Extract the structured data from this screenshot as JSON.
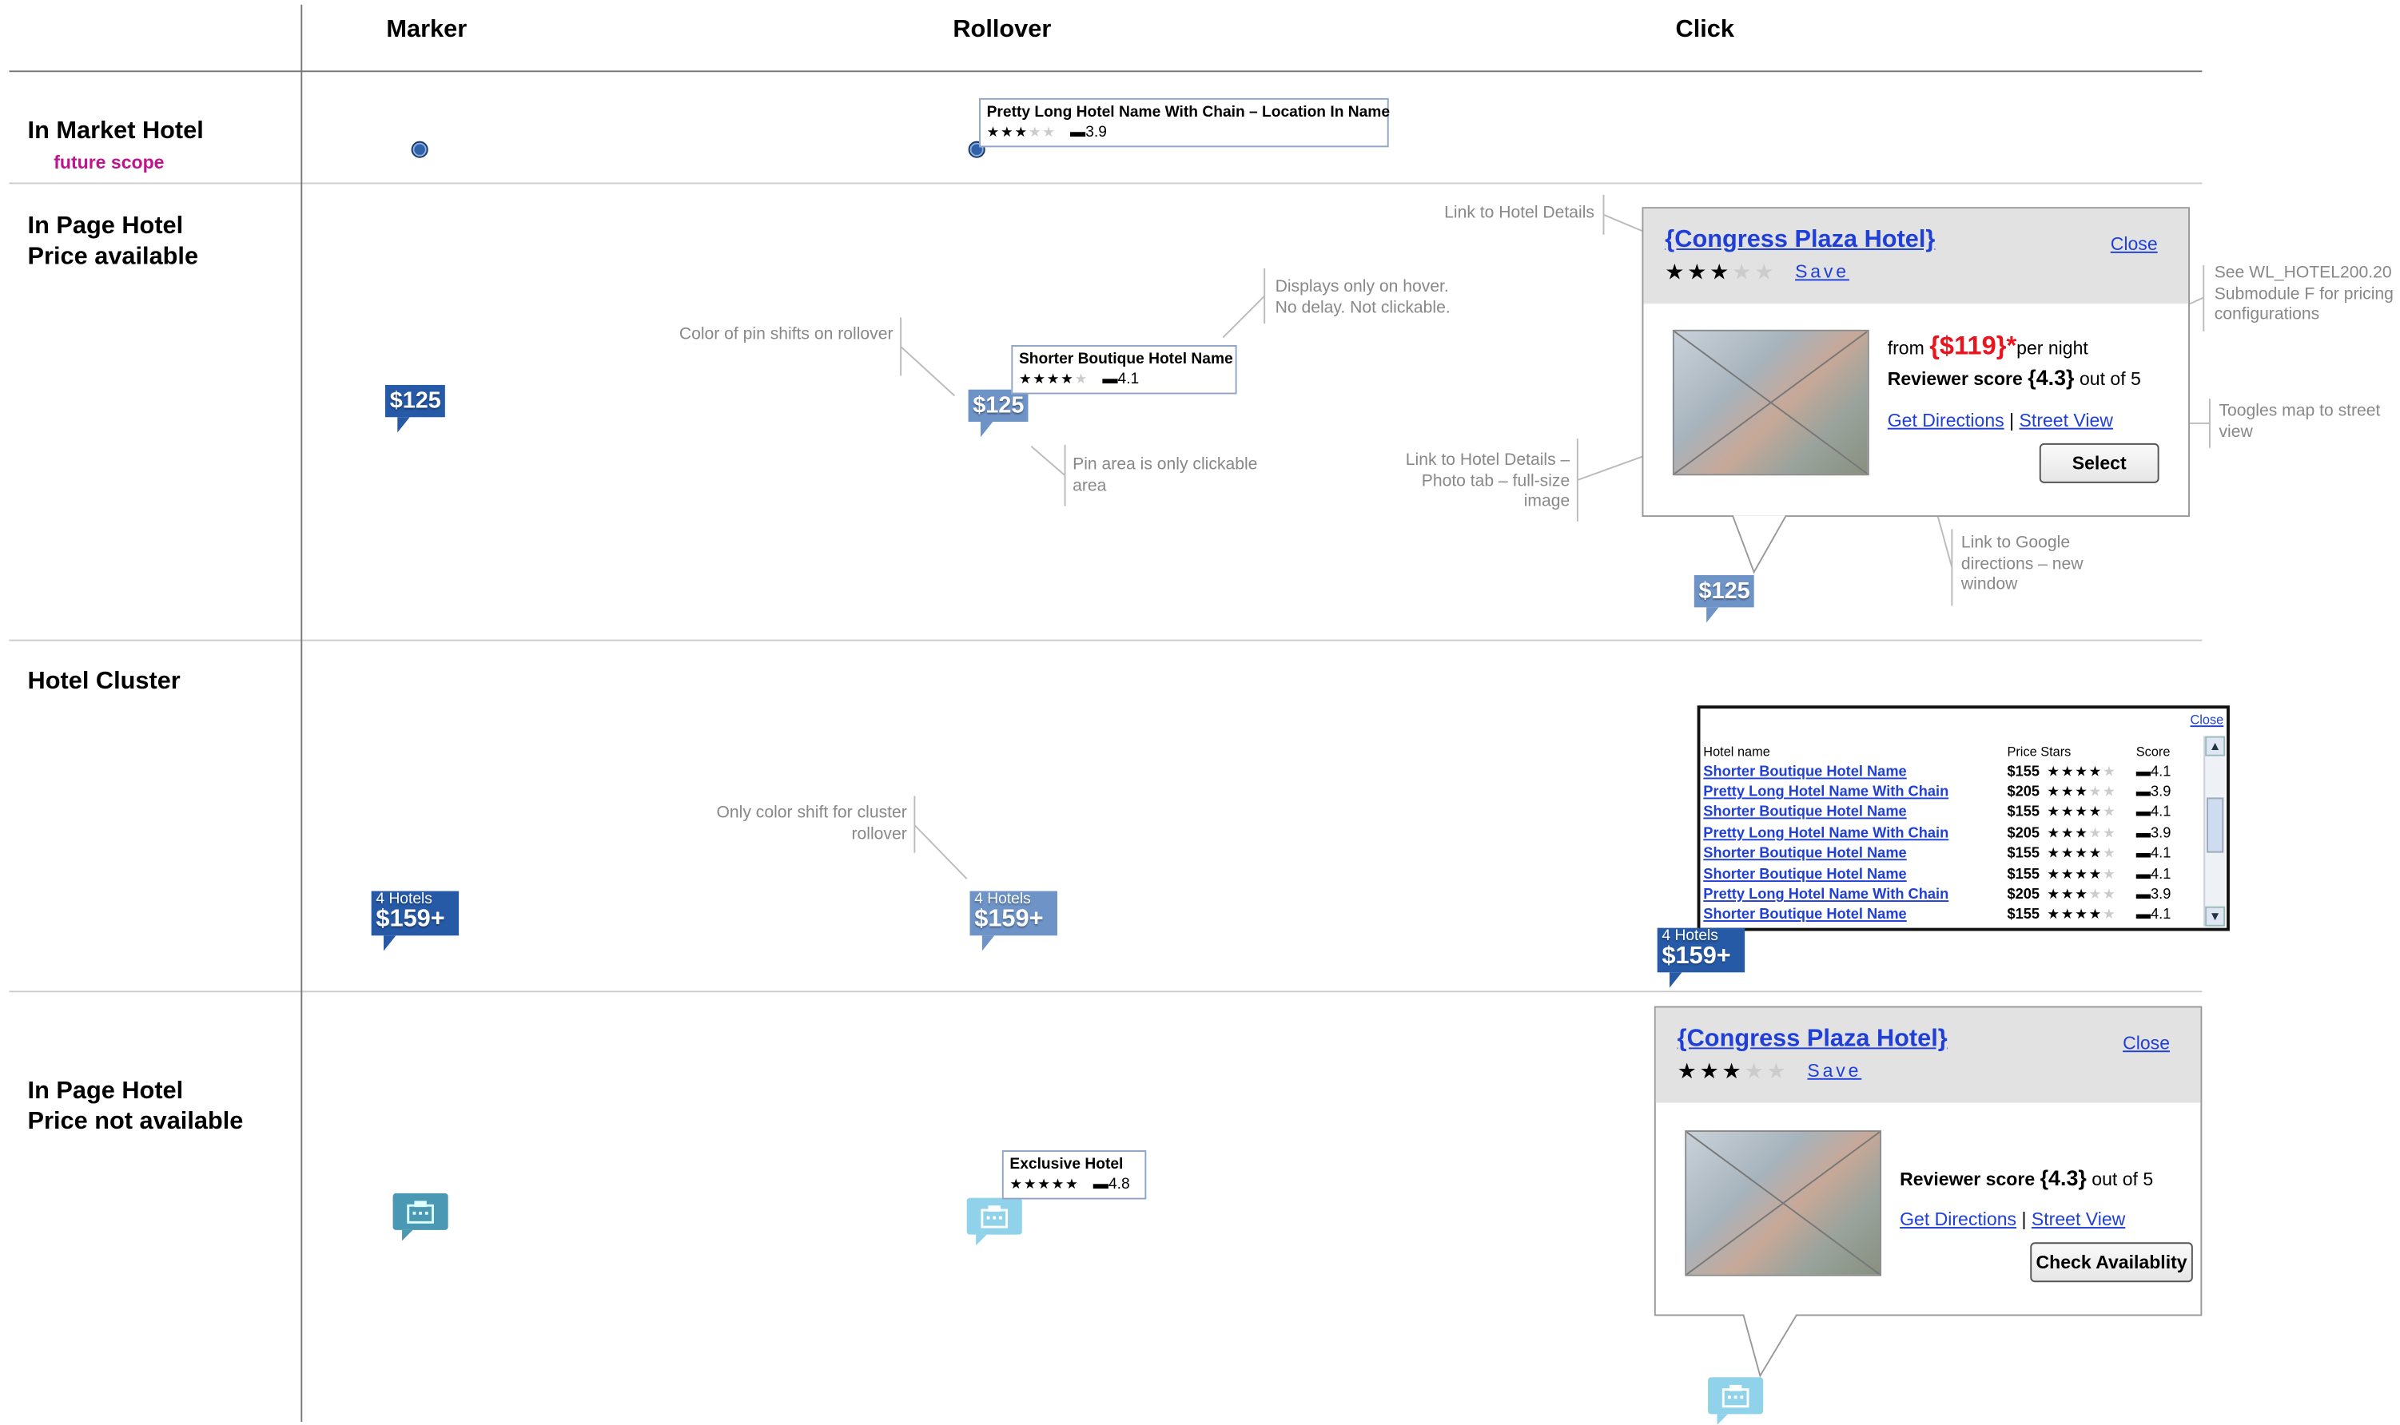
{
  "columns": {
    "marker": "Marker",
    "rollover": "Rollover",
    "click": "Click"
  },
  "rows": {
    "market": {
      "title": "In Market Hotel",
      "note": "future scope"
    },
    "price": {
      "title": "In Page Hotel\nPrice available"
    },
    "cluster": {
      "title": "Hotel Cluster"
    },
    "noprice": {
      "title": "In Page Hotel\nPrice not available"
    }
  },
  "market_rollover": {
    "name": "Pretty Long Hotel Name With Chain – Location In Name",
    "stars_on": "★★★",
    "stars_off": "★★",
    "reviews": "3.9"
  },
  "price_pin": "$125",
  "price_rollover": {
    "name": "Shorter Boutique Hotel Name",
    "stars_on": "★★★★",
    "stars_off": "★",
    "reviews": "4.1"
  },
  "annotations": {
    "pin_color": "Color of pin shifts on rollover",
    "hover": "Displays only on hover. No delay. Not clickable.",
    "pin_area": "Pin area is only clickable area",
    "hotel_details": "Link to Hotel Details",
    "photo_tab": "Link to Hotel Details – Photo tab – full-size image",
    "pricing": "See WL_HOTEL200.20 Submodule F for pricing configurations",
    "street": "Toogles map to street view",
    "google": "Link to Google directions – new window",
    "cluster_color": "Only color shift for cluster rollover"
  },
  "card_price": {
    "title": "{Congress Plaza Hotel}",
    "close": "Close",
    "stars_on": "★★★",
    "stars_off": "★★",
    "save": "Save",
    "from": "from",
    "price": "{$119}*",
    "per_night": "per night",
    "score_label": "Reviewer score",
    "score": "{4.3}",
    "out_of": "out of 5",
    "directions": "Get Directions",
    "sep": "|",
    "street_view": "Street View",
    "select": "Select"
  },
  "cluster_pin": {
    "count": "4 Hotels",
    "price": "$159+"
  },
  "cluster_list": {
    "close": "Close",
    "headers": {
      "name": "Hotel name",
      "price": "Price",
      "stars": "Stars",
      "score": "Score"
    },
    "rows": [
      {
        "name": "Shorter Boutique Hotel Name",
        "price": "$155",
        "stars_on": "★★★★",
        "stars_off": "★",
        "score": "4.1"
      },
      {
        "name": "Pretty Long Hotel Name With Chain",
        "price": "$205",
        "stars_on": "★★★",
        "stars_off": "★★",
        "score": "3.9"
      },
      {
        "name": "Shorter Boutique Hotel Name",
        "price": "$155",
        "stars_on": "★★★★",
        "stars_off": "★",
        "score": "4.1"
      },
      {
        "name": "Pretty Long Hotel Name With Chain",
        "price": "$205",
        "stars_on": "★★★",
        "stars_off": "★★",
        "score": "3.9"
      },
      {
        "name": "Shorter Boutique Hotel Name",
        "price": "$155",
        "stars_on": "★★★★",
        "stars_off": "★",
        "score": "4.1"
      },
      {
        "name": "Shorter Boutique Hotel Name",
        "price": "$155",
        "stars_on": "★★★★",
        "stars_off": "★",
        "score": "4.1"
      },
      {
        "name": "Pretty Long Hotel Name With Chain",
        "price": "$205",
        "stars_on": "★★★",
        "stars_off": "★★",
        "score": "3.9"
      },
      {
        "name": "Shorter Boutique Hotel Name",
        "price": "$155",
        "stars_on": "★★★★",
        "stars_off": "★",
        "score": "4.1"
      }
    ]
  },
  "noprice_rollover": {
    "name": "Exclusive Hotel",
    "stars_on": "★★★★★",
    "stars_off": "",
    "reviews": "4.8"
  },
  "card_noprice": {
    "title": "{Congress Plaza Hotel}",
    "close": "Close",
    "stars_on": "★★★",
    "stars_off": "★★",
    "save": "Save",
    "score_label": "Reviewer score",
    "score": "{4.3}",
    "out_of": "out of 5",
    "directions": "Get Directions",
    "sep": "|",
    "street_view": "Street View",
    "check": "Check Availablity"
  },
  "icons": {
    "marker_dot": "map-dot-icon",
    "hotel": "hotel-building-icon",
    "review": "speech-bubble-icon",
    "scroll_up": "chevron-up-icon",
    "scroll_down": "chevron-down-icon"
  },
  "colors": {
    "pin_dark": "#2659a6",
    "pin_light": "#6d93c7",
    "hotel_pin_dark": "#4a98b3",
    "hotel_pin_light": "#8fd2ea",
    "link": "#1f3fd6",
    "price_red": "#e8141e",
    "future_scope": "#c0148c"
  }
}
